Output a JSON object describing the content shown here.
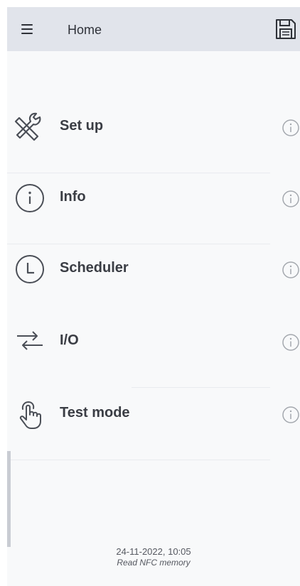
{
  "header": {
    "title": "Home",
    "menu_icon": "menu-icon",
    "save_icon": "floppy-disk-icon"
  },
  "menu": {
    "items": [
      {
        "label": "Set up",
        "icon": "tools-icon",
        "info_icon": "info-icon"
      },
      {
        "label": "Info",
        "icon": "info-circle-icon",
        "info_icon": "info-icon"
      },
      {
        "label": "Scheduler",
        "icon": "clock-icon",
        "info_icon": "info-icon"
      },
      {
        "label": "I/O",
        "icon": "swap-arrows-icon",
        "info_icon": "info-icon"
      },
      {
        "label": "Test mode",
        "icon": "touch-hand-icon",
        "info_icon": "info-icon"
      }
    ]
  },
  "footer": {
    "datetime": "24-11-2022, 10:05",
    "status": "Read NFC memory"
  },
  "colors": {
    "app_bar": "#e1e4eb",
    "background": "#f8f9fa",
    "text": "#3a3d44",
    "icon": "#4b4f57",
    "info_icon": "#a4a8ae"
  }
}
